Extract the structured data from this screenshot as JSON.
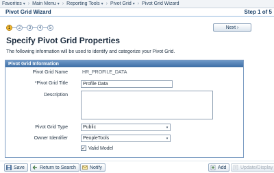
{
  "nav": {
    "items": [
      {
        "label": "Favorites",
        "has_arrow": true
      },
      {
        "label": "Main Menu",
        "has_arrow": true
      },
      {
        "label": "Reporting Tools",
        "has_arrow": true
      },
      {
        "label": "Pivot Grid",
        "has_arrow": true
      },
      {
        "label": "Pivot Grid Wizard",
        "has_arrow": false
      }
    ],
    "separator": "›",
    "arrow_glyph": "▾"
  },
  "header": {
    "title": "Pivot Grid Wizard",
    "step_label": "Step 1 of 5"
  },
  "steps": {
    "numbers": [
      "1",
      "2",
      "3",
      "4",
      "5"
    ],
    "current": 1,
    "next_label": "Next ›"
  },
  "page": {
    "title": "Specify Pivot Grid Properties",
    "intro": "The following information will be used to identify and categorize your Pivot Grid."
  },
  "group": {
    "header": "Pivot Grid Information",
    "fields": {
      "name": {
        "label": "Pivot Grid Name",
        "value": "HR_PROFILE_DATA"
      },
      "title": {
        "label": "*Pivot Grid Title",
        "value": "Profile Data"
      },
      "description": {
        "label": "Description",
        "value": ""
      },
      "type": {
        "label": "Pivot Grid Type",
        "value": "Public"
      },
      "owner": {
        "label": "Owner Identifier",
        "value": "PeopleTools"
      },
      "valid_model": {
        "label": "Valid Model",
        "checked": true,
        "check_glyph": "✓"
      }
    }
  },
  "toolbar": {
    "save": "Save",
    "return_to_search": "Return to Search",
    "notify": "Notify",
    "add": "Add",
    "update_display": "Update/Display"
  },
  "colors": {
    "header_text": "#163d66",
    "group_header": "#3d6ea5",
    "active_step": "#f2b92f"
  }
}
